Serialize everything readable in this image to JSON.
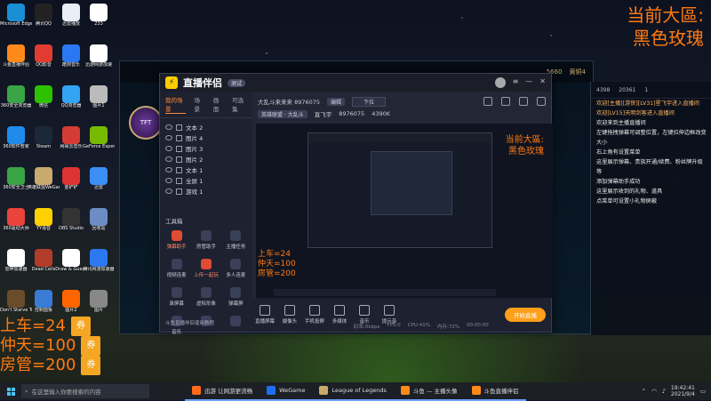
{
  "overlay": {
    "right_line1": "当前大區:",
    "right_line2": "黑色玫瑰",
    "left_rows": [
      {
        "text": "上车=24",
        "tag": "券"
      },
      {
        "text": "仲天=100",
        "tag": "券"
      },
      {
        "text": "房管=200",
        "tag": "券"
      }
    ]
  },
  "desktop_icons": [
    {
      "label": "Microsoft Edge",
      "color": "#1a8fd6"
    },
    {
      "label": "腾讯QQ",
      "color": "#222"
    },
    {
      "label": "迅雷播放",
      "color": "#e9eef7"
    },
    {
      "label": "233",
      "color": "#ffffff"
    },
    {
      "label": "斗鱼直播伴侣",
      "color": "#ff8a1a"
    },
    {
      "label": "QQ影音",
      "color": "#e03c31"
    },
    {
      "label": "酷狗音乐",
      "color": "#2c78f2"
    },
    {
      "label": "迅游网游加速",
      "color": "#ffffff"
    },
    {
      "label": "360安全浏览器",
      "color": "#3aa544"
    },
    {
      "label": "微信",
      "color": "#2dc100"
    },
    {
      "label": "QQ浏览器",
      "color": "#33a3f4"
    },
    {
      "label": "图片1",
      "color": "#bbb"
    },
    {
      "label": "360软件管家",
      "color": "#1f8ceb"
    },
    {
      "label": "Steam",
      "color": "#1b2838"
    },
    {
      "label": "网易云音乐",
      "color": "#d43c33"
    },
    {
      "label": "GeForce Experience",
      "color": "#76b900"
    },
    {
      "label": "360安全卫士",
      "color": "#3aa544"
    },
    {
      "label": "英雄联盟WeGame",
      "color": "#c8aa6e"
    },
    {
      "label": "金铲铲",
      "color": "#d33"
    },
    {
      "label": "迅雷",
      "color": "#3a8ef6"
    },
    {
      "label": "360驱动大师",
      "color": "#e9433b"
    },
    {
      "label": "YY语音",
      "color": "#ffd000"
    },
    {
      "label": "OBS Studio",
      "color": "#333"
    },
    {
      "label": "回收站",
      "color": "#6b8cc4"
    },
    {
      "label": "雷神加速器",
      "color": "#fff"
    },
    {
      "label": "Dead Cells",
      "color": "#b23c2a"
    },
    {
      "label": "Draw & Guess",
      "color": "#fff"
    },
    {
      "label": "腾讯网游加速器",
      "color": "#2c78f2"
    },
    {
      "label": "Don't Starve Together",
      "color": "#6a4b2a"
    },
    {
      "label": "控制面板",
      "color": "#3a7bd5"
    },
    {
      "label": "图片2",
      "color": "#f60"
    },
    {
      "label": "图片",
      "color": "#888"
    }
  ],
  "lol": {
    "currency": "5660",
    "rank": "黄铜4"
  },
  "chat": {
    "header": {
      "a": "4398",
      "b": "20361",
      "c": "1"
    },
    "messages": [
      {
        "text": "欢迎[主播][游侠][LV31]星飞宇进入直播间",
        "sys": true
      },
      {
        "text": "欢迎[LV15]天明剑客进入直播间",
        "sys": true
      },
      {
        "text": "欢迎来到主播直播间",
        "sys": false
      },
      {
        "text": "左键拖拽弹幕可调整位置，左键拉伸边框改变大小",
        "sys": false
      },
      {
        "text": "右上角有设置菜单",
        "sys": false
      },
      {
        "text": "这里展示弹幕、贵族开通/续费、粉丝牌升级等",
        "sys": false
      },
      {
        "text": "添加弹幕助手成功",
        "sys": false
      },
      {
        "text": "这里展示收到的礼物、道具",
        "sys": false
      },
      {
        "text": "点菜单可设置小礼物屏蔽",
        "sys": false
      }
    ]
  },
  "app": {
    "brand": "直播伴侣",
    "version": "测试",
    "tabs": [
      "我的场景",
      "场景",
      "画面",
      "可选集"
    ],
    "scenes": [
      "文本 2",
      "图片 4",
      "图片 3",
      "图片 2",
      "文本 1",
      "全屏 1",
      "游戏 1"
    ],
    "tools_title": "工具箱",
    "tools": [
      {
        "label": "弹幕助手",
        "red": true
      },
      {
        "label": "房管助手",
        "red": false
      },
      {
        "label": "主播任务",
        "red": false
      },
      {
        "label": "视频连麦",
        "red": false
      },
      {
        "label": "上传一起玩",
        "red": true
      },
      {
        "label": "多人连麦",
        "red": false
      },
      {
        "label": "录屏幕",
        "red": false
      },
      {
        "label": "虚拟形象",
        "red": false
      },
      {
        "label": "弹幕屏",
        "red": false
      },
      {
        "label": "音乐",
        "red": false
      },
      {
        "label": "",
        "red": false
      },
      {
        "label": "",
        "red": false
      }
    ],
    "footer": "斗鱼直播伴侣使用教程",
    "room_title": "大乱斗来来来 8976075",
    "edit_label": "编辑",
    "category": "下拉",
    "room_tag": "英雄联盟 · 大乱斗",
    "room_id_label": "直飞宇",
    "room_id": "8976075",
    "fans": "4390K",
    "controls": [
      "直播屏幕",
      "摄像头",
      "手机投屏",
      "多媒体",
      "音乐",
      "提示音"
    ],
    "go_live": "开始直播",
    "stats": [
      "码率:0kbps",
      "FPS:0",
      "CPU:41%",
      "内存:72%",
      "00:00:00"
    ]
  },
  "taskbar": {
    "search_placeholder": "在这里输入你要搜索的内容",
    "apps": [
      {
        "label": "迅游 让网游更流畅",
        "color": "#ff6a1a"
      },
      {
        "label": "WeGame",
        "color": "#1f6ff2"
      },
      {
        "label": "League of Legends",
        "color": "#c8aa6e"
      },
      {
        "label": "斗鱼 — 主播头像",
        "color": "#ff8a1a"
      },
      {
        "label": "斗鱼直播伴侣",
        "color": "#ff8a1a"
      }
    ],
    "time": "19:42:41",
    "date": "2021/9/4"
  }
}
